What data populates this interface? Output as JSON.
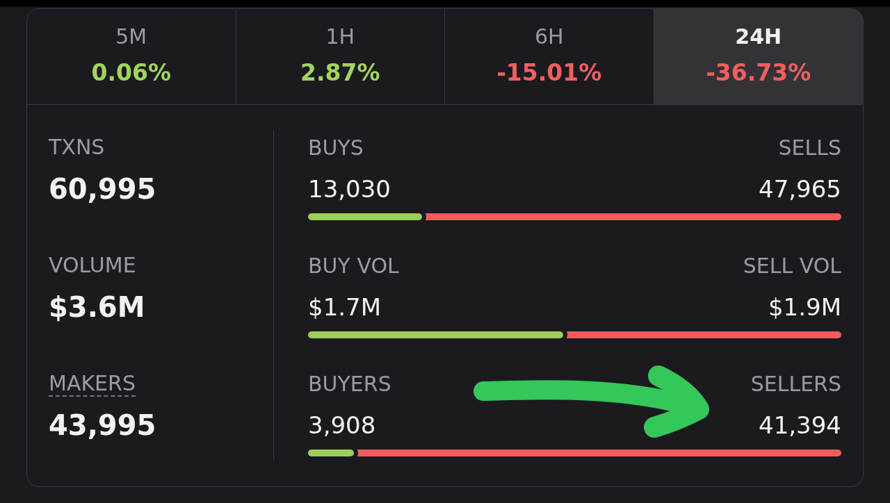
{
  "timeframes": [
    {
      "label": "5M",
      "change": "0.06%",
      "color": "#a2d45e",
      "selected": false
    },
    {
      "label": "1H",
      "change": "2.87%",
      "color": "#a2d45e",
      "selected": false
    },
    {
      "label": "6H",
      "change": "-15.01%",
      "color": "#f0605d",
      "selected": false
    },
    {
      "label": "24H",
      "change": "-36.73%",
      "color": "#f0605d",
      "selected": true
    }
  ],
  "metrics": [
    {
      "total": {
        "label": "TXNS",
        "value": "60,995",
        "underlined": false
      },
      "buy": {
        "label": "BUYS",
        "value": "13,030"
      },
      "sell": {
        "label": "SELLS",
        "value": "47,965"
      },
      "level": 0.214
    },
    {
      "total": {
        "label": "VOLUME",
        "value": "$3.6M",
        "underlined": false
      },
      "buy": {
        "label": "BUY VOL",
        "value": "$1.7M"
      },
      "sell": {
        "label": "SELL VOL",
        "value": "$1.9M"
      },
      "level": 0.478
    },
    {
      "total": {
        "label": "MAKERS",
        "value": "43,995",
        "underlined": true
      },
      "buy": {
        "label": "BUYERS",
        "value": "3,908"
      },
      "sell": {
        "label": "SELLERS",
        "value": "41,394"
      },
      "level": 0.086
    }
  ]
}
